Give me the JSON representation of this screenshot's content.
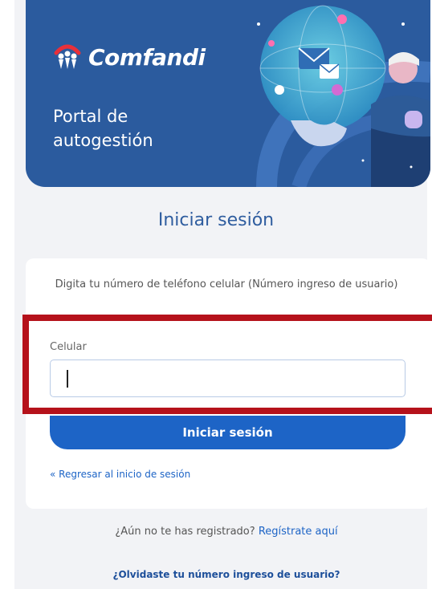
{
  "brand": {
    "name": "Comfandi",
    "subtitle_line1": "Portal de",
    "subtitle_line2": "autogestión",
    "colors": {
      "banner": "#2b5b9e",
      "accent": "#1d64c6",
      "highlight": "#b5121b"
    },
    "illustration": "globe-with-person-illustration"
  },
  "login": {
    "title": "Iniciar sesión",
    "instructions": "Digita tu número de teléfono celular (Número ingreso de usuario)",
    "phone_label": "Celular",
    "phone_value": "",
    "submit_label": "Iniciar sesión",
    "back_link": "« Regresar al inicio de sesión"
  },
  "footer": {
    "register_prompt": "¿Aún no te has registrado?",
    "register_link": "Regístrate aquí",
    "forgot_link": "¿Olvidaste tu número ingreso de usuario?"
  }
}
